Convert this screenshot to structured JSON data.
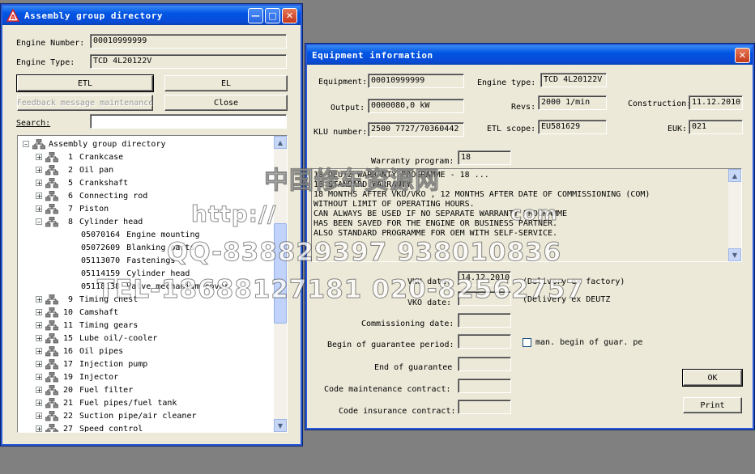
{
  "assembly_window": {
    "title": "Assembly group directory",
    "engine_number_label": "Engine Number:",
    "engine_number_value": "00010999999",
    "engine_type_label": "Engine Type:",
    "engine_type_value": "TCD 4L20122V",
    "etl_button": "ETL",
    "el_button": "EL",
    "feedback_button": "Feedback message maintenance",
    "close_button": "Close",
    "search_label": "Search:",
    "search_value": "",
    "tree_root": "Assembly group directory",
    "groups_top": [
      {
        "num": "1",
        "name": "Crankcase"
      },
      {
        "num": "2",
        "name": "Oil pan"
      },
      {
        "num": "5",
        "name": "Crankshaft"
      },
      {
        "num": "6",
        "name": "Connecting rod"
      },
      {
        "num": "7",
        "name": "Piston"
      },
      {
        "num": "8",
        "name": "Cylinder head"
      }
    ],
    "subitems": [
      {
        "code": "05070164",
        "name": "Engine mounting"
      },
      {
        "code": "05072609",
        "name": "Blanking parts"
      },
      {
        "code": "05113070",
        "name": "Fastenings"
      },
      {
        "code": "05114159",
        "name": "Cylinder head"
      },
      {
        "code": "05118138",
        "name": "Valve mechanism cover"
      }
    ],
    "groups_bottom": [
      {
        "num": "9",
        "name": "Timing chest"
      },
      {
        "num": "10",
        "name": "Camshaft"
      },
      {
        "num": "11",
        "name": "Timing gears"
      },
      {
        "num": "15",
        "name": "Lube oil/-cooler"
      },
      {
        "num": "16",
        "name": "Oil pipes"
      },
      {
        "num": "17",
        "name": "Injection pump"
      },
      {
        "num": "19",
        "name": "Injector"
      },
      {
        "num": "20",
        "name": "Fuel filter"
      },
      {
        "num": "21",
        "name": "Fuel pipes/fuel tank"
      },
      {
        "num": "22",
        "name": "Suction pipe/air cleaner"
      },
      {
        "num": "27",
        "name": "Speed control"
      }
    ]
  },
  "equipment_window": {
    "title": "Equipment information",
    "equipment_label": "Equipment:",
    "equipment_value": "00010999999",
    "engine_type_label": "Engine type:",
    "engine_type_value": "TCD 4L20122V",
    "output_label": "Output:",
    "output_value": "0000080,0 kW",
    "revs_label": "Revs:",
    "revs_value": "2000 1/min",
    "construction_label": "Construction:",
    "construction_value": "11.12.2010",
    "klu_label": "KLU number:",
    "klu_value": "2500 7727/70360442",
    "etl_label": "ETL scope:",
    "etl_value": "EU581629",
    "euk_label": "EUK:",
    "euk_value": "021",
    "warranty_label": "Warranty program:",
    "warranty_value": "18",
    "warranty_text": [
      "18 DEUTZ WARRANTY PROGRAMME - 18 ...",
      "18 STANDARD WARRANTY",
      "18 MONTHS AFTER VKU/VKO , 12 MONTHS AFTER DATE OF COMMISSIONING (COM)",
      "WITHOUT LIMIT OF OPERATING HOURS.",
      "CAN ALWAYS BE USED IF NO SEPARATE WARRANTY PROGRAMME",
      "HAS BEEN SAVED FOR THE ENGINE OR BUSINESS PARTNER.",
      "ALSO STANDARD PROGRAMME FOR OEM WITH SELF-SERVICE."
    ],
    "vku_label": "VKU date:",
    "vku_value": "14.12.2010",
    "vku_note": "(Delivery ex factory)",
    "vko_label": "VKO date:",
    "vko_value": "",
    "vko_note": "(Delivery ex DEUTZ",
    "commissioning_label": "Commissioning date:",
    "begin_guarantee_label": "Begin of guarantee period:",
    "man_begin_label": "man. begin of guar. pe",
    "end_guarantee_label": "End of guarantee",
    "code_maint_label": "Code maintenance contract:",
    "code_insurance_label": "Code insurance contract:",
    "ok_button": "OK",
    "print_button": "Print"
  },
  "watermark": {
    "line1": "中国修车资源网",
    "line2": "http://",
    "line2b": "com",
    "line3": "QQ-838829397 938010836",
    "line4": "TEL-18688127181 020-82562757"
  }
}
